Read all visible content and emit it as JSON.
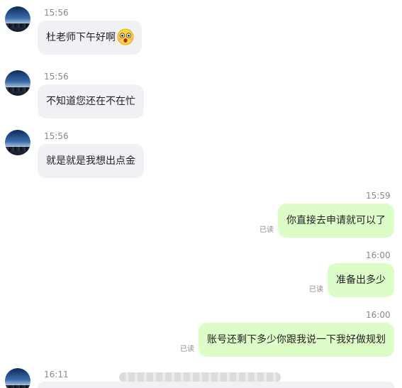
{
  "messages": [
    {
      "time": "15:56",
      "text": "杜老师下午好啊",
      "emoji": "shocked-face-emoji"
    },
    {
      "time": "15:56",
      "text": "不知道您还在不在忙"
    },
    {
      "time": "15:56",
      "text": "就是就是我想出点金"
    },
    {
      "time": "15:59",
      "text": "你直接去申请就可以了",
      "status": "已读"
    },
    {
      "time": "16:00",
      "text": "准备出多少",
      "status": "已读"
    },
    {
      "time": "16:00",
      "text": "账号还剩下多少你跟我说一下我好做规划",
      "status": "已读"
    },
    {
      "time": "16:11"
    }
  ],
  "colors": {
    "incoming_bubble": "#f0f1f5",
    "outgoing_bubble": "#ddfdc8",
    "timestamp": "#8a8a8a"
  }
}
